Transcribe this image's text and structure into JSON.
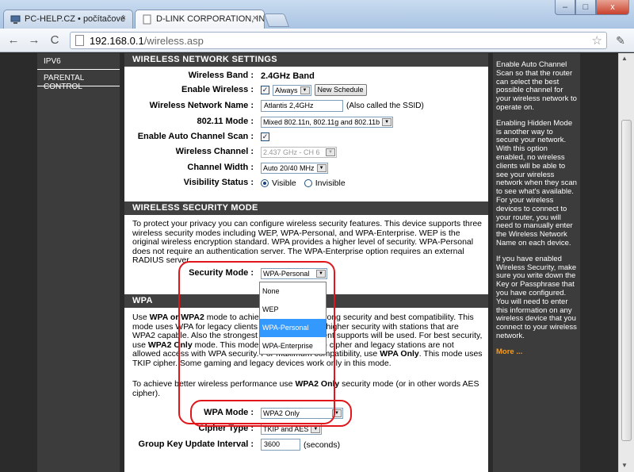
{
  "browser": {
    "tabs": [
      {
        "title": "PC-HELP.CZ • počítačové"
      },
      {
        "title": "D-LINK CORPORATION, IN"
      }
    ],
    "close_glyph": "×",
    "url_host": "192.168.0.1",
    "url_path": "/wireless.asp",
    "back_glyph": "←",
    "forward_glyph": "→",
    "reload_glyph": "C",
    "star_glyph": "☆",
    "wrench_glyph": "✎",
    "win_min": "–",
    "win_max": "□",
    "win_close": "x"
  },
  "left_nav": {
    "items": [
      "IPV6",
      "PARENTAL CONTROL"
    ]
  },
  "wireless_settings": {
    "heading": "WIRELESS NETWORK SETTINGS",
    "band_label": "Wireless Band :",
    "band_value": "2.4GHz Band",
    "enable_label": "Enable Wireless :",
    "enable_schedule": "Always",
    "new_schedule_button": "New Schedule",
    "ssid_label": "Wireless Network Name :",
    "ssid_value": "Atlantis 2,4GHz",
    "ssid_note": "(Also called the SSID)",
    "mode_label": "802.11 Mode :",
    "mode_value": "Mixed 802.11n, 802.11g and 802.11b",
    "auto_scan_label": "Enable Auto Channel Scan :",
    "channel_label": "Wireless Channel :",
    "channel_value": "2.437 GHz - CH 6",
    "width_label": "Channel Width :",
    "width_value": "Auto 20/40 MHz",
    "visibility_label": "Visibility Status :",
    "visible_option": "Visible",
    "invisible_option": "Invisible",
    "checkmark": "✓",
    "dropdown_arrow": "▼"
  },
  "security_mode": {
    "heading": "WIRELESS SECURITY MODE",
    "description": "To protect your privacy you can configure wireless security features. This device supports three wireless security modes including WEP, WPA-Personal, and WPA-Enterprise. WEP is the original wireless encryption standard. WPA provides a higher level of security. WPA-Personal does not require an authentication server. The WPA-Enterprise option requires an external RADIUS server.",
    "label": "Security Mode :",
    "value": "WPA-Personal",
    "options": [
      "None",
      "WEP",
      "WPA-Personal",
      "WPA-Enterprise"
    ]
  },
  "wpa": {
    "heading": "WPA",
    "description_html_parts": [
      "Use ",
      "WPA or WPA2",
      " mode to achieve a balance of strong security and best compatibility. This mode uses WPA for legacy clients while maintaining higher security with stations that are WPA2 capable. Also the strongest cipher that the client supports will be used. For best security, use ",
      "WPA2 Only",
      " mode. This mode uses AES(CCMP) cipher and legacy stations are not allowed access with WPA security. For maximum compatibility, use ",
      "WPA Only",
      ". This mode uses TKIP cipher. Some gaming and legacy devices work only in this mode."
    ],
    "tip_prefix": "To achieve better wireless performance use ",
    "tip_bold": "WPA2 Only",
    "tip_suffix": " security mode (or in other words AES cipher).",
    "mode_label": "WPA Mode :",
    "mode_value": "WPA2 Only",
    "cipher_label": "Cipher Type :",
    "cipher_value": "TKIP and AES",
    "group_key_label": "Group Key Update Interval :",
    "group_key_value": "3600",
    "group_key_unit": "(seconds)"
  },
  "help": {
    "p1": "Enable Auto Channel Scan so that the router can select the best possible channel for your wireless network to operate on.",
    "p2": "Enabling Hidden Mode is another way to secure your network. With this option enabled, no wireless clients will be able to see your wireless network when they scan to see what's available. For your wireless devices to connect to your router, you will need to manually enter the Wireless Network Name on each device.",
    "p3": "If you have enabled Wireless Security, make sure you write down the Key or Passphrase that you have configured. You will need to enter this information on any wireless device that you connect to your wireless network.",
    "more": "More ..."
  },
  "colors": {
    "highlight": "#e0161b",
    "section_header": "#404040",
    "selected_option": "#3399ff",
    "more_link": "#f89c1c"
  }
}
